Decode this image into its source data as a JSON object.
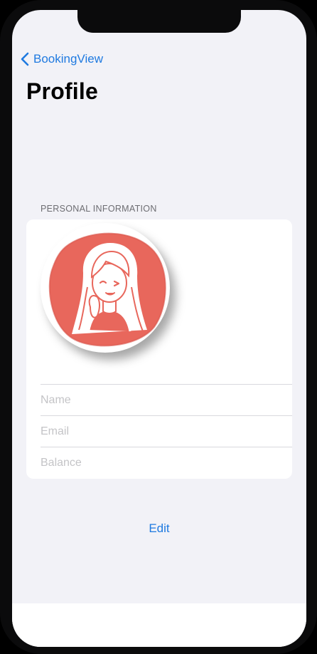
{
  "nav": {
    "back_label": "BookingView",
    "back_icon": "chevron-left-icon"
  },
  "page": {
    "title": "Profile"
  },
  "personal": {
    "section_header": "PERSONAL INFORMATION",
    "avatar_icon": "avatar-illustration-icon",
    "fields": {
      "name_placeholder": "Name",
      "email_placeholder": "Email",
      "balance_placeholder": "Balance"
    }
  },
  "actions": {
    "edit_label": "Edit"
  },
  "colors": {
    "accent": "#1f7ae0",
    "background": "#f2f2f7",
    "avatar_red": "#e8675c"
  }
}
